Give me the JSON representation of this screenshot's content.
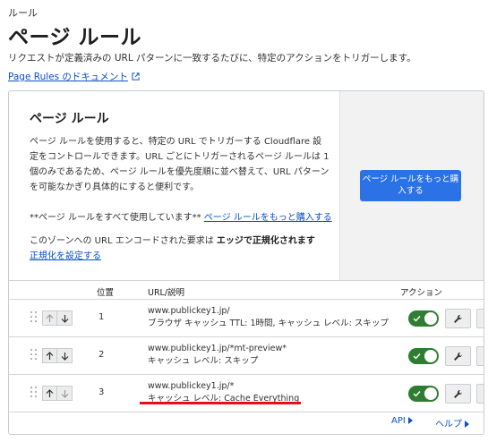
{
  "breadcrumb": "ルール",
  "page_title": "ページ ルール",
  "description": "リクエストが定義済みの URL パターンに一致するたびに、特定のアクションをトリガーします。",
  "doc_link": "Page Rules のドキュメント",
  "promo": {
    "title": "ページ ルール",
    "body": "ページ ルールを使用すると、特定の URL でトリガーする Cloudflare 設定をコントロールできます。URL ごとにトリガーされるページ ルールは 1 個のみであるため、ページ ルールを優先度順に並べ替えて、URL パターンを可能なかぎり具体的にすると便利です。",
    "usage_prefix": "**ページ ルールをすべて使用しています**",
    "usage_link": "ページ ルールをもっと購入する",
    "normalize_prefix": "このゾーンへの URL エンコードされた要求は",
    "normalize_bold": "エッジで正規化されます",
    "normalize_link": "正規化を設定する",
    "buy_button": "ページ ルールをもっと購入する"
  },
  "table": {
    "headers": {
      "position": "位置",
      "url": "URL/説明",
      "action": "アクション"
    },
    "rows": [
      {
        "position": "1",
        "url": "www.publickey1.jp/",
        "detail": "ブラウザ キャッシュ TTL: 1時間, キャッシュ レベル: スキップ",
        "enabled": true
      },
      {
        "position": "2",
        "url": "www.publickey1.jp/*mt-preview*",
        "detail": "キャッシュ レベル: スキップ",
        "enabled": true
      },
      {
        "position": "3",
        "url": "www.publickey1.jp/*",
        "detail": "キャッシュ レベル: Cache Everything",
        "enabled": true
      }
    ]
  },
  "footer": {
    "api": "API",
    "help": "ヘルプ"
  },
  "colors": {
    "link": "#0a4fc7",
    "button": "#2a72e6",
    "toggle_on": "#2f7d32",
    "highlight": "#e3101a"
  },
  "icons": [
    "external-link-icon",
    "drag-handle-icon",
    "arrow-up-icon",
    "arrow-down-icon",
    "check-icon",
    "wrench-icon",
    "triangle-right-icon"
  ]
}
